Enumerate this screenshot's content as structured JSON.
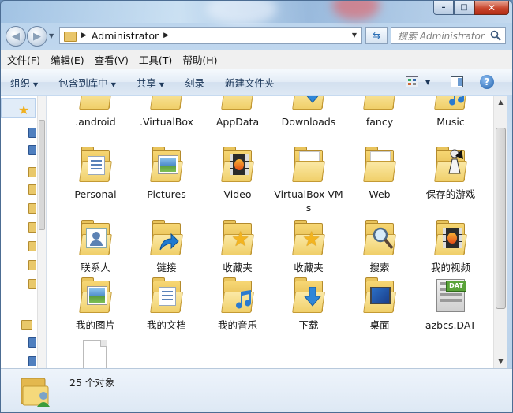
{
  "window": {
    "caption_min": "–",
    "caption_max": "□",
    "caption_close": "✕"
  },
  "address": {
    "path": [
      "Administrator"
    ],
    "search_placeholder": "搜索 Administrator"
  },
  "menu": [
    {
      "label": "文件(F)"
    },
    {
      "label": "编辑(E)"
    },
    {
      "label": "查看(V)"
    },
    {
      "label": "工具(T)"
    },
    {
      "label": "帮助(H)"
    }
  ],
  "commands": [
    {
      "label": "组织",
      "dropdown": true
    },
    {
      "label": "包含到库中",
      "dropdown": true
    },
    {
      "label": "共享",
      "dropdown": true
    },
    {
      "label": "刻录",
      "dropdown": false
    },
    {
      "label": "新建文件夹",
      "dropdown": false
    }
  ],
  "items": [
    {
      "label": ".android",
      "type": "folder"
    },
    {
      "label": ".VirtualBox",
      "type": "folder"
    },
    {
      "label": "AppData",
      "type": "folder"
    },
    {
      "label": "Downloads",
      "type": "folder-download"
    },
    {
      "label": "fancy",
      "type": "folder"
    },
    {
      "label": "Music",
      "type": "folder-music"
    },
    {
      "label": "Personal",
      "type": "folder-doc"
    },
    {
      "label": "Pictures",
      "type": "folder-pic"
    },
    {
      "label": "Video",
      "type": "folder-video"
    },
    {
      "label": "VirtualBox VMs",
      "type": "folder"
    },
    {
      "label": "Web",
      "type": "folder"
    },
    {
      "label": "保存的游戏",
      "type": "folder-game"
    },
    {
      "label": "联系人",
      "type": "folder-contact"
    },
    {
      "label": "链接",
      "type": "folder-link"
    },
    {
      "label": "收藏夹",
      "type": "folder-star"
    },
    {
      "label": "收藏夹",
      "type": "folder-star"
    },
    {
      "label": "搜索",
      "type": "folder-search"
    },
    {
      "label": "我的视频",
      "type": "folder-video"
    },
    {
      "label": "我的图片",
      "type": "folder-pic"
    },
    {
      "label": "我的文档",
      "type": "folder-doc"
    },
    {
      "label": "我的音乐",
      "type": "folder-music"
    },
    {
      "label": "下载",
      "type": "folder-download"
    },
    {
      "label": "桌面",
      "type": "folder-desktop"
    },
    {
      "label": "azbcs.DAT",
      "type": "file-dat"
    },
    {
      "label": "",
      "type": "file-blank"
    }
  ],
  "dat_badge": "DAT",
  "status": {
    "count_text": "25 个对象"
  },
  "colors": {
    "command_text": "#1e395b",
    "folder": "#f0cf69",
    "accent_blue": "#2c6fb5"
  }
}
